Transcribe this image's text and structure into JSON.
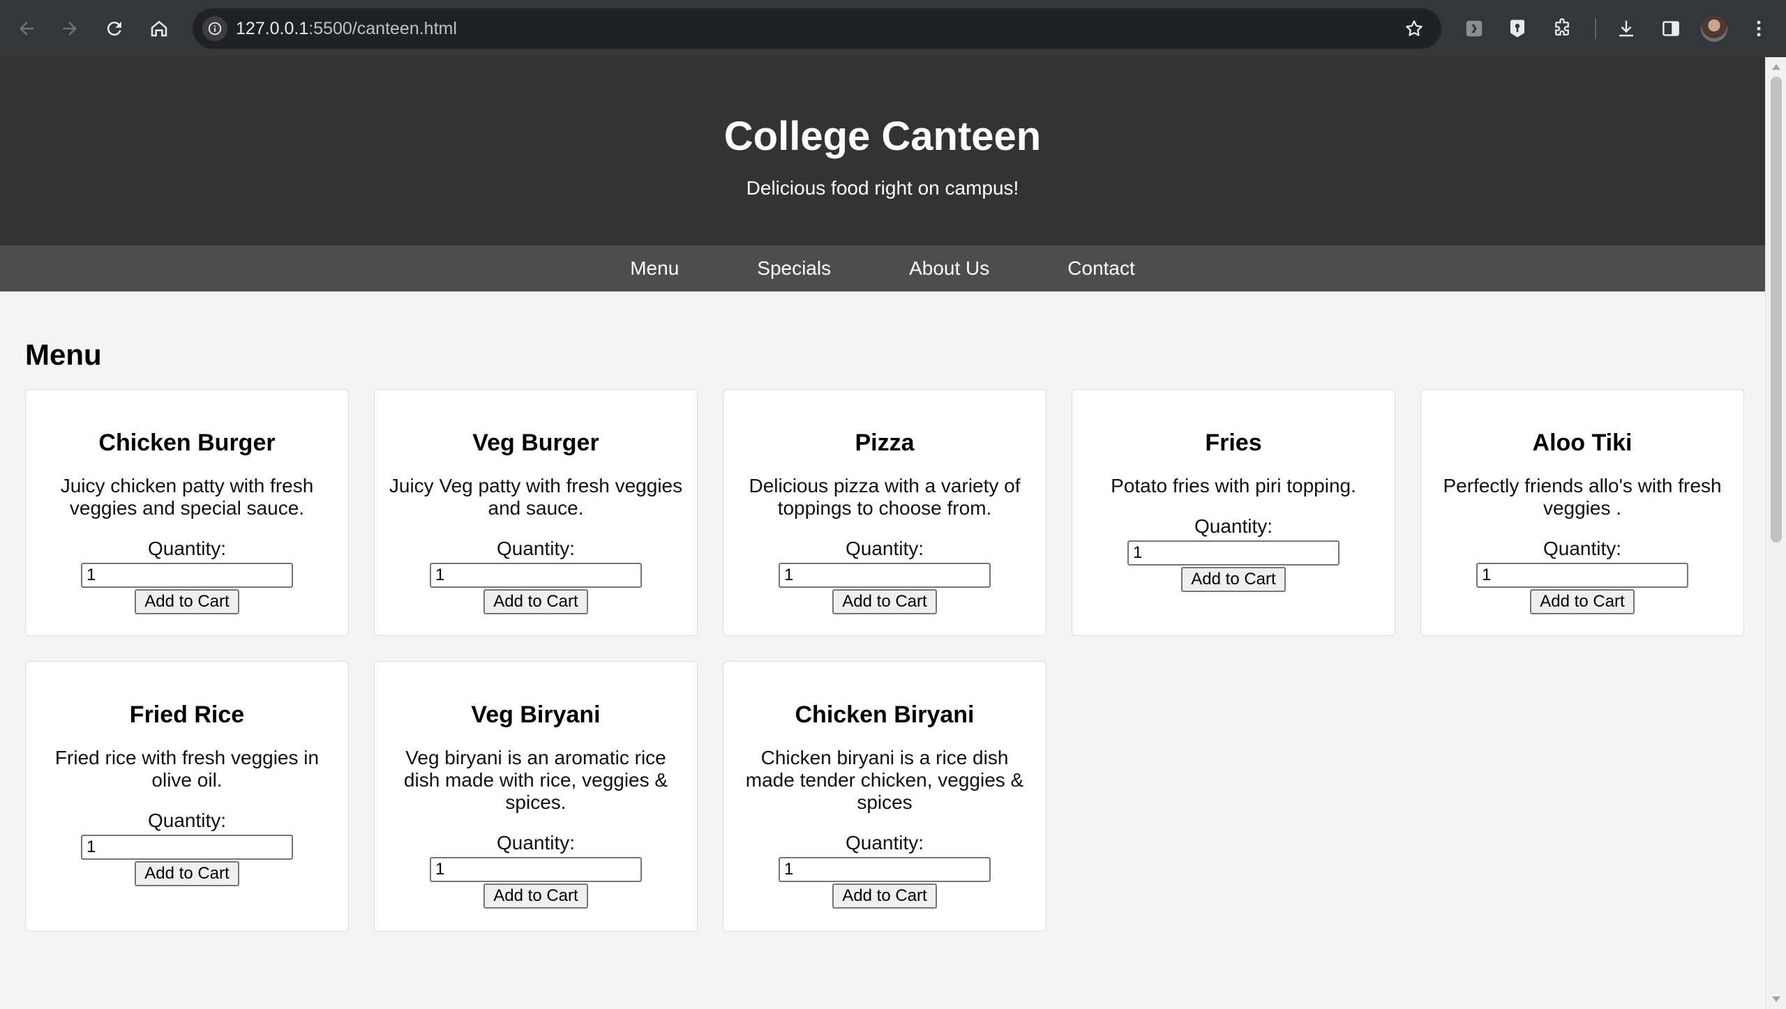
{
  "browser": {
    "url_host": "127.0.0.1",
    "url_rest": ":5500/canteen.html"
  },
  "site": {
    "title": "College Canteen",
    "tagline": "Delicious food right on campus!",
    "nav": [
      "Menu",
      "Specials",
      "About Us",
      "Contact"
    ]
  },
  "menu": {
    "heading": "Menu",
    "qty_label": "Quantity:",
    "button_label": "Add to Cart",
    "items": [
      {
        "name": "Chicken Burger",
        "desc": "Juicy chicken patty with fresh veggies and special sauce.",
        "qty": "1"
      },
      {
        "name": "Veg Burger",
        "desc": "Juicy Veg patty with fresh veggies and sauce.",
        "qty": "1"
      },
      {
        "name": "Pizza",
        "desc": "Delicious pizza with a variety of toppings to choose from.",
        "qty": "1"
      },
      {
        "name": "Fries",
        "desc": "Potato fries with piri topping.",
        "qty": "1"
      },
      {
        "name": "Aloo Tiki",
        "desc": "Perfectly friends allo's with fresh veggies .",
        "qty": "1"
      },
      {
        "name": "Fried Rice",
        "desc": "Fried rice with fresh veggies in olive oil.",
        "qty": "1"
      },
      {
        "name": "Veg Biryani",
        "desc": "Veg biryani is an aromatic rice dish made with rice, veggies & spices.",
        "qty": "1"
      },
      {
        "name": "Chicken Biryani",
        "desc": "Chicken biryani is a rice dish made tender chicken, veggies & spices",
        "qty": "1"
      }
    ]
  }
}
